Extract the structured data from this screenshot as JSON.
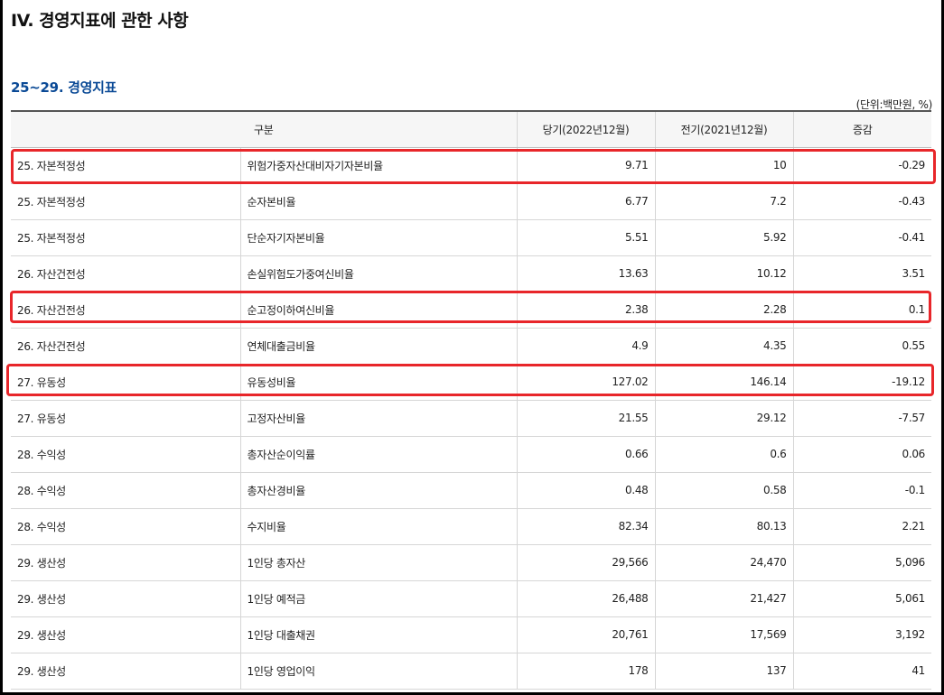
{
  "page": {
    "title": "IV. 경영지표에 관한 사항",
    "section_title": "25~29. 경영지표",
    "unit_note": "(단위:백만원, %)"
  },
  "table": {
    "headers": [
      "구분",
      "당기(2022년12월)",
      "전기(2021년12월)",
      "증감"
    ],
    "rows": [
      {
        "category": "25. 자본적정성",
        "item": "위험가중자산대비자기자본비율",
        "current": "9.71",
        "previous": "10",
        "change": "-0.29"
      },
      {
        "category": "25. 자본적정성",
        "item": "순자본비율",
        "current": "6.77",
        "previous": "7.2",
        "change": "-0.43"
      },
      {
        "category": "25. 자본적정성",
        "item": "단순자기자본비율",
        "current": "5.51",
        "previous": "5.92",
        "change": "-0.41"
      },
      {
        "category": "26. 자산건전성",
        "item": "손실위험도가중여신비율",
        "current": "13.63",
        "previous": "10.12",
        "change": "3.51"
      },
      {
        "category": "26. 자산건전성",
        "item": "순고정이하여신비율",
        "current": "2.38",
        "previous": "2.28",
        "change": "0.1"
      },
      {
        "category": "26. 자산건전성",
        "item": "연체대출금비율",
        "current": "4.9",
        "previous": "4.35",
        "change": "0.55"
      },
      {
        "category": "27. 유동성",
        "item": "유동성비율",
        "current": "127.02",
        "previous": "146.14",
        "change": "-19.12"
      },
      {
        "category": "27. 유동성",
        "item": "고정자산비율",
        "current": "21.55",
        "previous": "29.12",
        "change": "-7.57"
      },
      {
        "category": "28. 수익성",
        "item": "총자산순이익률",
        "current": "0.66",
        "previous": "0.6",
        "change": "0.06"
      },
      {
        "category": "28. 수익성",
        "item": "총자산경비율",
        "current": "0.48",
        "previous": "0.58",
        "change": "-0.1"
      },
      {
        "category": "28. 수익성",
        "item": "수지비율",
        "current": "82.34",
        "previous": "80.13",
        "change": "2.21"
      },
      {
        "category": "29. 생산성",
        "item": "1인당 총자산",
        "current": "29,566",
        "previous": "24,470",
        "change": "5,096"
      },
      {
        "category": "29. 생산성",
        "item": "1인당 예적금",
        "current": "26,488",
        "previous": "21,427",
        "change": "5,061"
      },
      {
        "category": "29. 생산성",
        "item": "1인당 대출채권",
        "current": "20,761",
        "previous": "17,569",
        "change": "3,192"
      },
      {
        "category": "29. 생산성",
        "item": "1인당 영업이익",
        "current": "178",
        "previous": "137",
        "change": "41"
      }
    ]
  },
  "highlights": {
    "color": "#e8262a",
    "highlighted_items": [
      "위험가중자산대비자기자본비율",
      "순고정이하여신비율",
      "유동성비율"
    ]
  },
  "colors": {
    "section_title": "#0b4a96",
    "header_background": "#f6f6f6"
  }
}
